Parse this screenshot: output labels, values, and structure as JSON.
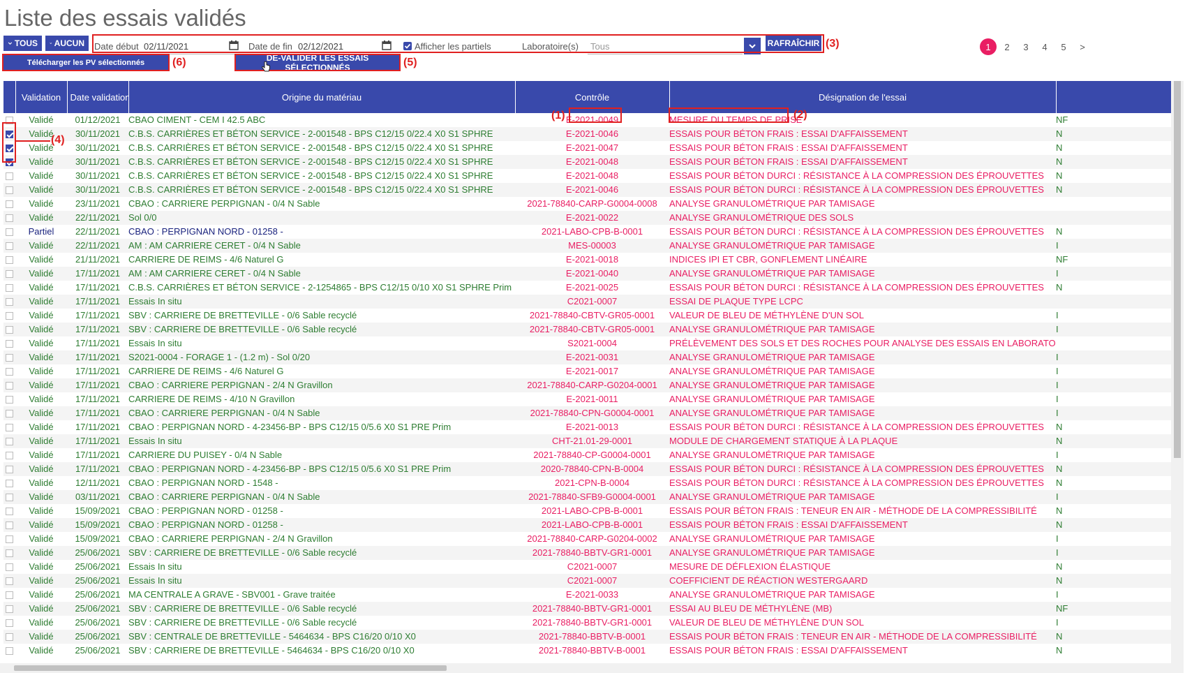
{
  "page_title": "Liste des essais validés",
  "toolbar": {
    "tous_label": "TOUS",
    "aucun_label": "AUCUN",
    "date_debut_label": "Date début",
    "date_debut_value": "02/11/2021",
    "date_fin_label": "Date de fin",
    "date_fin_value": "02/12/2021",
    "afficher_partiels_label": "Afficher les partiels",
    "afficher_partiels_checked": true,
    "laboratoire_label": "Laboratoire(s)",
    "laboratoire_value": "Tous",
    "refresh_label": "RAFRAÎCHIR",
    "download_label": "Télécharger les PV sélectionnés",
    "devalidate_label": "DÉ-VALIDER LES ESSAIS SÉLECTIONNÉS"
  },
  "annotations": {
    "a1": "(1)",
    "a2": "(2)",
    "a3": "(3)",
    "a4": "(4)",
    "a5": "(5)",
    "a6": "(6)"
  },
  "pagination": {
    "pages": [
      "1",
      "2",
      "3",
      "4",
      "5"
    ],
    "active": "1",
    "next": ">"
  },
  "table": {
    "columns": [
      "",
      "Validation",
      "Date validation",
      "Origine du matériau",
      "Contrôle",
      "Désignation de l'essai",
      ""
    ],
    "rows": [
      {
        "checked": false,
        "status": "Validé",
        "date": "01/12/2021",
        "origine": "CBAO CIMENT - CEM I 42.5 ABC",
        "controle": "E-2021-0049",
        "designation": "MESURE DU TEMPS DE PRISE",
        "extra": "NF"
      },
      {
        "checked": true,
        "status": "Validé",
        "date": "30/11/2021",
        "origine": "C.B.S. CARRIÈRES ET BÉTON SERVICE - 2-001548 - BPS C12/15 0/22.4 X0 S1 SPHRE",
        "controle": "E-2021-0046",
        "designation": "ESSAIS POUR BÉTON FRAIS : ESSAI D'AFFAISSEMENT",
        "extra": "N"
      },
      {
        "checked": true,
        "status": "Validé",
        "date": "30/11/2021",
        "origine": "C.B.S. CARRIÈRES ET BÉTON SERVICE - 2-001548 - BPS C12/15 0/22.4 X0 S1 SPHRE",
        "controle": "E-2021-0047",
        "designation": "ESSAIS POUR BÉTON FRAIS : ESSAI D'AFFAISSEMENT",
        "extra": "N"
      },
      {
        "checked": true,
        "status": "Validé",
        "date": "30/11/2021",
        "origine": "C.B.S. CARRIÈRES ET BÉTON SERVICE - 2-001548 - BPS C12/15 0/22.4 X0 S1 SPHRE",
        "controle": "E-2021-0048",
        "designation": "ESSAIS POUR BÉTON FRAIS : ESSAI D'AFFAISSEMENT",
        "extra": "N"
      },
      {
        "checked": false,
        "status": "Validé",
        "date": "30/11/2021",
        "origine": "C.B.S. CARRIÈRES ET BÉTON SERVICE - 2-001548 - BPS C12/15 0/22.4 X0 S1 SPHRE",
        "controle": "E-2021-0048",
        "designation": "ESSAIS POUR BÉTON DURCI : RÉSISTANCE À LA COMPRESSION DES ÉPROUVETTES",
        "extra": "N"
      },
      {
        "checked": false,
        "status": "Validé",
        "date": "30/11/2021",
        "origine": "C.B.S. CARRIÈRES ET BÉTON SERVICE - 2-001548 - BPS C12/15 0/22.4 X0 S1 SPHRE",
        "controle": "E-2021-0046",
        "designation": "ESSAIS POUR BÉTON DURCI : RÉSISTANCE À LA COMPRESSION DES ÉPROUVETTES",
        "extra": "N"
      },
      {
        "checked": false,
        "status": "Validé",
        "date": "23/11/2021",
        "origine": "CBAO : CARRIERE PERPIGNAN - 0/4 N Sable",
        "controle": "2021-78840-CARP-G0004-0008",
        "designation": "ANALYSE GRANULOMÉTRIQUE PAR TAMISAGE",
        "extra": ""
      },
      {
        "checked": false,
        "status": "Validé",
        "date": "22/11/2021",
        "origine": "Sol 0/0",
        "controle": "E-2021-0022",
        "designation": "ANALYSE GRANULOMÉTRIQUE DES SOLS",
        "extra": ""
      },
      {
        "checked": false,
        "status": "Partiel",
        "date": "22/11/2021",
        "origine": "CBAO : PERPIGNAN NORD - 01258 -",
        "controle": "2021-LABO-CPB-B-0001",
        "designation": "ESSAIS POUR BÉTON DURCI : RÉSISTANCE À LA COMPRESSION DES ÉPROUVETTES",
        "extra": "N"
      },
      {
        "checked": false,
        "status": "Validé",
        "date": "22/11/2021",
        "origine": "AM : AM CARRIERE CERET - 0/4 N Sable",
        "controle": "MES-00003",
        "designation": "ANALYSE GRANULOMÉTRIQUE PAR TAMISAGE",
        "extra": "I"
      },
      {
        "checked": false,
        "status": "Validé",
        "date": "21/11/2021",
        "origine": "CARRIERE DE REIMS - 4/6 Naturel G",
        "controle": "E-2021-0018",
        "designation": "INDICES IPI ET CBR, GONFLEMENT LINÉAIRE",
        "extra": "NF"
      },
      {
        "checked": false,
        "status": "Validé",
        "date": "17/11/2021",
        "origine": "AM : AM CARRIERE CERET - 0/4 N Sable",
        "controle": "E-2021-0040",
        "designation": "ANALYSE GRANULOMÉTRIQUE PAR TAMISAGE",
        "extra": "I"
      },
      {
        "checked": false,
        "status": "Validé",
        "date": "17/11/2021",
        "origine": "C.B.S. CARRIÈRES ET BÉTON SERVICE - 2-1254865 - BPS C12/15 0/10 X0 S1 SPHRE Prim",
        "controle": "E-2021-0025",
        "designation": "ESSAIS POUR BÉTON DURCI : RÉSISTANCE À LA COMPRESSION DES ÉPROUVETTES",
        "extra": "N"
      },
      {
        "checked": false,
        "status": "Validé",
        "date": "17/11/2021",
        "origine": "Essais In situ",
        "controle": "C2021-0007",
        "designation": "ESSAI DE PLAQUE TYPE LCPC",
        "extra": ""
      },
      {
        "checked": false,
        "status": "Validé",
        "date": "17/11/2021",
        "origine": "SBV : CARRIERE DE BRETTEVILLE - 0/6 Sable recyclé",
        "controle": "2021-78840-CBTV-GR05-0001",
        "designation": "VALEUR DE BLEU DE MÉTHYLÈNE D'UN SOL",
        "extra": "I"
      },
      {
        "checked": false,
        "status": "Validé",
        "date": "17/11/2021",
        "origine": "SBV : CARRIERE DE BRETTEVILLE - 0/6 Sable recyclé",
        "controle": "2021-78840-CBTV-GR05-0001",
        "designation": "ANALYSE GRANULOMÉTRIQUE PAR TAMISAGE",
        "extra": "I"
      },
      {
        "checked": false,
        "status": "Validé",
        "date": "17/11/2021",
        "origine": "Essais In situ",
        "controle": "S2021-0004",
        "designation": "PRÉLÈVEMENT DES SOLS ET DES ROCHES POUR ANALYSE DES ESSAIS EN LABORATOIRE",
        "extra": ""
      },
      {
        "checked": false,
        "status": "Validé",
        "date": "17/11/2021",
        "origine": "S2021-0004 - FORAGE 1 - (1.2 m) - Sol 0/20",
        "controle": "E-2021-0031",
        "designation": "ANALYSE GRANULOMÉTRIQUE PAR TAMISAGE",
        "extra": "I"
      },
      {
        "checked": false,
        "status": "Validé",
        "date": "17/11/2021",
        "origine": "CARRIERE DE REIMS - 4/6 Naturel G",
        "controle": "E-2021-0017",
        "designation": "ANALYSE GRANULOMÉTRIQUE PAR TAMISAGE",
        "extra": "I"
      },
      {
        "checked": false,
        "status": "Validé",
        "date": "17/11/2021",
        "origine": "CBAO : CARRIERE PERPIGNAN - 2/4 N Gravillon",
        "controle": "2021-78840-CARP-G0204-0001",
        "designation": "ANALYSE GRANULOMÉTRIQUE PAR TAMISAGE",
        "extra": "I"
      },
      {
        "checked": false,
        "status": "Validé",
        "date": "17/11/2021",
        "origine": "CARRIERE DE REIMS - 4/10 N Gravillon",
        "controle": "E-2021-0011",
        "designation": "ANALYSE GRANULOMÉTRIQUE PAR TAMISAGE",
        "extra": "I"
      },
      {
        "checked": false,
        "status": "Validé",
        "date": "17/11/2021",
        "origine": "CBAO : CARRIERE PERPIGNAN - 0/4 N Sable",
        "controle": "2021-78840-CPN-G0004-0001",
        "designation": "ANALYSE GRANULOMÉTRIQUE PAR TAMISAGE",
        "extra": "I"
      },
      {
        "checked": false,
        "status": "Validé",
        "date": "17/11/2021",
        "origine": "CBAO : PERPIGNAN NORD - 4-23456-BP - BPS C12/15 0/5.6 X0 S1 PRE Prim",
        "controle": "E-2021-0013",
        "designation": "ESSAIS POUR BÉTON DURCI : RÉSISTANCE À LA COMPRESSION DES ÉPROUVETTES",
        "extra": "N"
      },
      {
        "checked": false,
        "status": "Validé",
        "date": "17/11/2021",
        "origine": "Essais In situ",
        "controle": "CHT-21.01-29-0001",
        "designation": "MODULE DE CHARGEMENT STATIQUE À LA PLAQUE",
        "extra": "N"
      },
      {
        "checked": false,
        "status": "Validé",
        "date": "17/11/2021",
        "origine": "CARRIERE DU PUISEY - 0/4 N Sable",
        "controle": "2021-78840-CP-G0004-0001",
        "designation": "ANALYSE GRANULOMÉTRIQUE PAR TAMISAGE",
        "extra": "I"
      },
      {
        "checked": false,
        "status": "Validé",
        "date": "17/11/2021",
        "origine": "CBAO : PERPIGNAN NORD - 4-23456-BP - BPS C12/15 0/5.6 X0 S1 PRE Prim",
        "controle": "2020-78840-CPN-B-0004",
        "designation": "ESSAIS POUR BÉTON DURCI : RÉSISTANCE À LA COMPRESSION DES ÉPROUVETTES",
        "extra": "N"
      },
      {
        "checked": false,
        "status": "Validé",
        "date": "12/11/2021",
        "origine": "CBAO : PERPIGNAN NORD - 1548 -",
        "controle": "2021-CPN-B-0004",
        "designation": "ESSAIS POUR BÉTON DURCI : RÉSISTANCE À LA COMPRESSION DES ÉPROUVETTES",
        "extra": "N"
      },
      {
        "checked": false,
        "status": "Validé",
        "date": "03/11/2021",
        "origine": "CBAO : CARRIERE PERPIGNAN - 0/4 N Sable",
        "controle": "2021-78840-SFB9-G0004-0001",
        "designation": "ANALYSE GRANULOMÉTRIQUE PAR TAMISAGE",
        "extra": "I"
      },
      {
        "checked": false,
        "status": "Validé",
        "date": "15/09/2021",
        "origine": "CBAO : PERPIGNAN NORD - 01258 -",
        "controle": "2021-LABO-CPB-B-0001",
        "designation": "ESSAIS POUR BÉTON FRAIS : TENEUR EN AIR - MÉTHODE DE LA COMPRESSIBILITÉ",
        "extra": "N"
      },
      {
        "checked": false,
        "status": "Validé",
        "date": "15/09/2021",
        "origine": "CBAO : PERPIGNAN NORD - 01258 -",
        "controle": "2021-LABO-CPB-B-0001",
        "designation": "ESSAIS POUR BÉTON FRAIS : ESSAI D'AFFAISSEMENT",
        "extra": "N"
      },
      {
        "checked": false,
        "status": "Validé",
        "date": "15/09/2021",
        "origine": "CBAO : CARRIERE PERPIGNAN - 2/4 N Gravillon",
        "controle": "2021-78840-CARP-G0204-0002",
        "designation": "ANALYSE GRANULOMÉTRIQUE PAR TAMISAGE",
        "extra": "I"
      },
      {
        "checked": false,
        "status": "Validé",
        "date": "25/06/2021",
        "origine": "SBV : CARRIERE DE BRETTEVILLE - 0/6 Sable recyclé",
        "controle": "2021-78840-BBTV-GR1-0001",
        "designation": "ANALYSE GRANULOMÉTRIQUE PAR TAMISAGE",
        "extra": "I"
      },
      {
        "checked": false,
        "status": "Validé",
        "date": "25/06/2021",
        "origine": "Essais In situ",
        "controle": "C2021-0007",
        "designation": "MESURE DE DÉFLEXION ÉLASTIQUE",
        "extra": "N"
      },
      {
        "checked": false,
        "status": "Validé",
        "date": "25/06/2021",
        "origine": "Essais In situ",
        "controle": "C2021-0007",
        "designation": "COEFFICIENT DE RÉACTION WESTERGAARD",
        "extra": "N"
      },
      {
        "checked": false,
        "status": "Validé",
        "date": "25/06/2021",
        "origine": "MA CENTRALE A GRAVE - SBV001 - Grave traitée",
        "controle": "E-2021-0033",
        "designation": "ANALYSE GRANULOMÉTRIQUE PAR TAMISAGE",
        "extra": "I"
      },
      {
        "checked": false,
        "status": "Validé",
        "date": "25/06/2021",
        "origine": "SBV : CARRIERE DE BRETTEVILLE - 0/6 Sable recyclé",
        "controle": "2021-78840-BBTV-GR1-0001",
        "designation": "ESSAI AU BLEU DE MÉTHYLÈNE (MB)",
        "extra": "NF"
      },
      {
        "checked": false,
        "status": "Validé",
        "date": "25/06/2021",
        "origine": "SBV : CARRIERE DE BRETTEVILLE - 0/6 Sable recyclé",
        "controle": "2021-78840-BBTV-GR1-0001",
        "designation": "VALEUR DE BLEU DE MÉTHYLÈNE D'UN SOL",
        "extra": "I"
      },
      {
        "checked": false,
        "status": "Validé",
        "date": "25/06/2021",
        "origine": "SBV : CENTRALE DE BRETTEVILLE - 5464634 - BPS C16/20 0/10 X0",
        "controle": "2021-78840-BBTV-B-0001",
        "designation": "ESSAIS POUR BÉTON FRAIS : TENEUR EN AIR - MÉTHODE DE LA COMPRESSIBILITÉ",
        "extra": "N"
      },
      {
        "checked": false,
        "status": "Validé",
        "date": "25/06/2021",
        "origine": "SBV : CARRIERE DE BRETTEVILLE - 5464634 - BPS C16/20 0/10 X0",
        "controle": "2021-78840-BBTV-B-0001",
        "designation": "ESSAIS POUR BÉTON FRAIS : ESSAI D'AFFAISSEMENT",
        "extra": "N"
      }
    ]
  }
}
